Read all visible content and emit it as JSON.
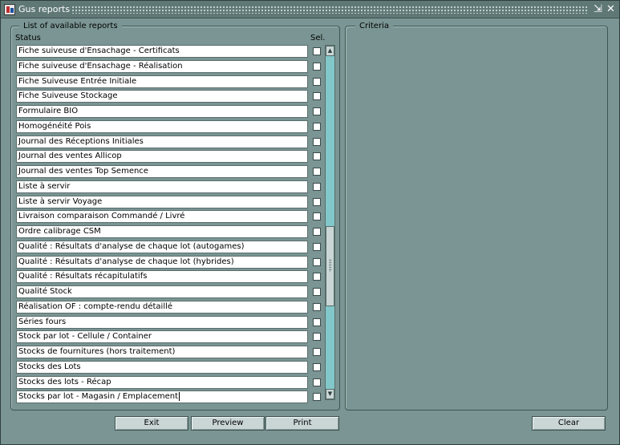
{
  "window": {
    "title": "Gus reports",
    "minimize_glyph": "⇲",
    "close_glyph": "✕"
  },
  "list_panel": {
    "legend": "List of available reports",
    "col_status": "Status",
    "col_sel": "Sel.",
    "current_index": 23,
    "rows": [
      "Fiche suiveuse d'Ensachage - Certificats",
      "Fiche suiveuse d'Ensachage - Réalisation",
      "Fiche Suiveuse Entrée Initiale",
      "Fiche Suiveuse Stockage",
      "Formulaire BIO",
      "Homogénéité Pois",
      "Journal des Réceptions Initiales",
      "Journal des ventes Allicop",
      "Journal des ventes Top Semence",
      "Liste à servir",
      "Liste à servir Voyage",
      "Livraison comparaison Commandé / Livré",
      "Ordre calibrage CSM",
      "Qualité : Résultats d'analyse de chaque lot (autogames)",
      "Qualité : Résultats d'analyse de chaque lot (hybrides)",
      "Qualité : Résultats récapitulatifs",
      "Qualité Stock",
      "Réalisation OF : compte-rendu détaillé",
      "Séries fours",
      "Stock par lot - Cellule / Container",
      "Stocks de fournitures (hors traitement)",
      "Stocks des Lots",
      "Stocks des lots - Récap",
      "Stocks par lot - Magasin / Emplacement"
    ]
  },
  "criteria_panel": {
    "legend": "Criteria"
  },
  "scrollbar": {
    "up_glyph": "▲",
    "down_glyph": "▼",
    "position_fraction": 0.55
  },
  "buttons": {
    "exit": "Exit",
    "preview": "Preview",
    "print": "Print",
    "clear": "Clear"
  },
  "colors": {
    "background": "#7a9593",
    "titlebar": "#5f7876",
    "scroll_track": "#82c7c9"
  }
}
